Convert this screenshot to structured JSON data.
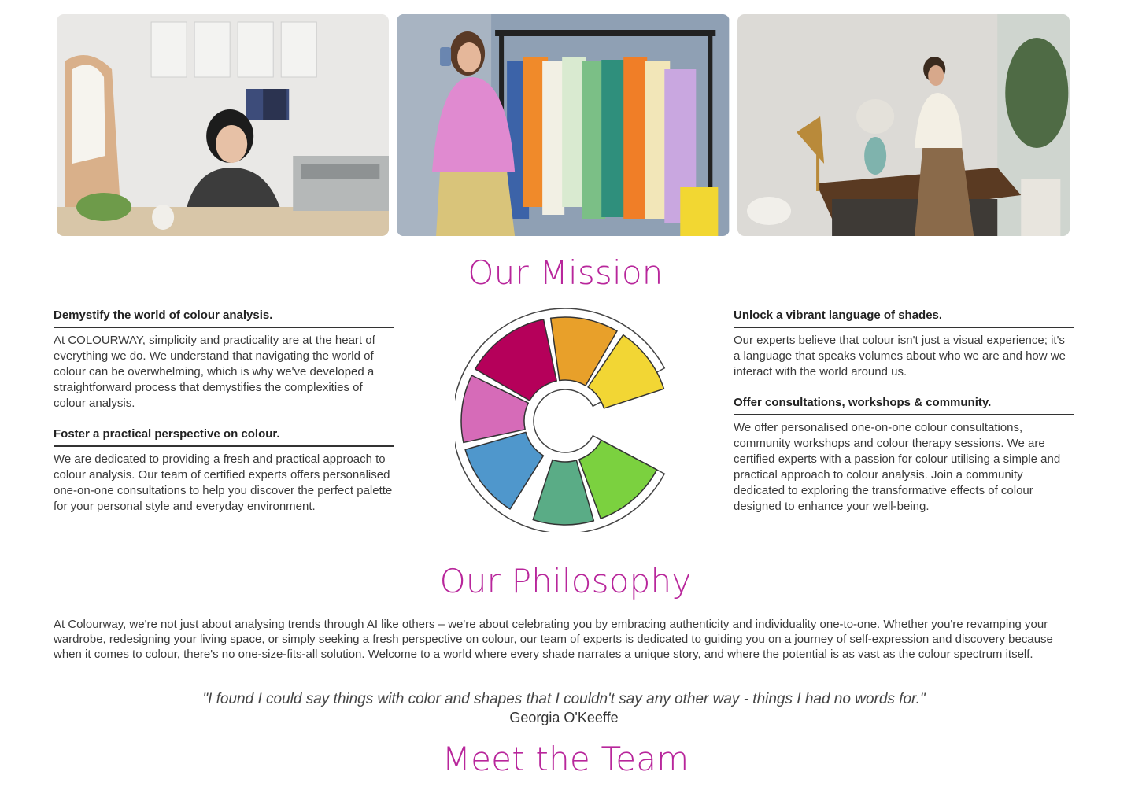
{
  "photos": [
    {
      "name": "designer-at-desk-photo"
    },
    {
      "name": "woman-selfie-clothing-rack-photo"
    },
    {
      "name": "woman-arranging-vase-photo"
    }
  ],
  "mission": {
    "title": "Our Mission",
    "left": [
      {
        "heading": "Demystify the world of colour analysis.",
        "body": "At COLOURWAY, simplicity and practicality are at the heart of everything we do. We understand that navigating the world of colour can be overwhelming, which is why we've developed a straightforward process that demystifies the complexities of colour analysis."
      },
      {
        "heading": "Foster a practical perspective on colour.",
        "body": "We are dedicated to providing a fresh and practical approach to colour analysis. Our team of certified experts offers personalised one-on-one consultations to help you discover the perfect palette for your personal style and everyday environment."
      }
    ],
    "right": [
      {
        "heading": "Unlock a vibrant language of shades.",
        "body": "Our experts believe that colour isn't just a visual experience; it's a language that speaks volumes about who we are and how we interact with the world around us."
      },
      {
        "heading": "Offer consultations, workshops & community.",
        "body": "We offer personalised one-on-one colour consultations, community workshops and colour therapy sessions. We are certified experts with a passion for colour utilising a simple and practical approach to colour analysis. Join a community dedicated to exploring the transformative effects of colour designed to enhance your well-being."
      }
    ],
    "wheel_colors": [
      "#b5005a",
      "#e8a02a",
      "#f2d634",
      "#d66bb8",
      "#4f97cc",
      "#5aac86",
      "#7bd13f"
    ]
  },
  "philosophy": {
    "title": "Our Philosophy",
    "body": "At Colourway, we're not just about analysing trends through AI like others – we're about celebrating you by embracing authenticity and individuality one-to-one. Whether you're revamping your wardrobe, redesigning your living space, or simply seeking a fresh perspective on colour, our team of experts is dedicated to guiding you on a journey of self-expression and discovery because when it comes to colour, there's no one-size-fits-all solution. Welcome to a world where every shade narrates a unique story, and where the potential is as vast as the colour spectrum itself.",
    "quote": "\"I found I could say things with color and shapes that I couldn't say any other way - things I had no words for.\"",
    "quote_author": "Georgia O'Keeffe"
  },
  "team": {
    "title": "Meet the Team"
  },
  "colors": {
    "accent": "#b8269b"
  }
}
